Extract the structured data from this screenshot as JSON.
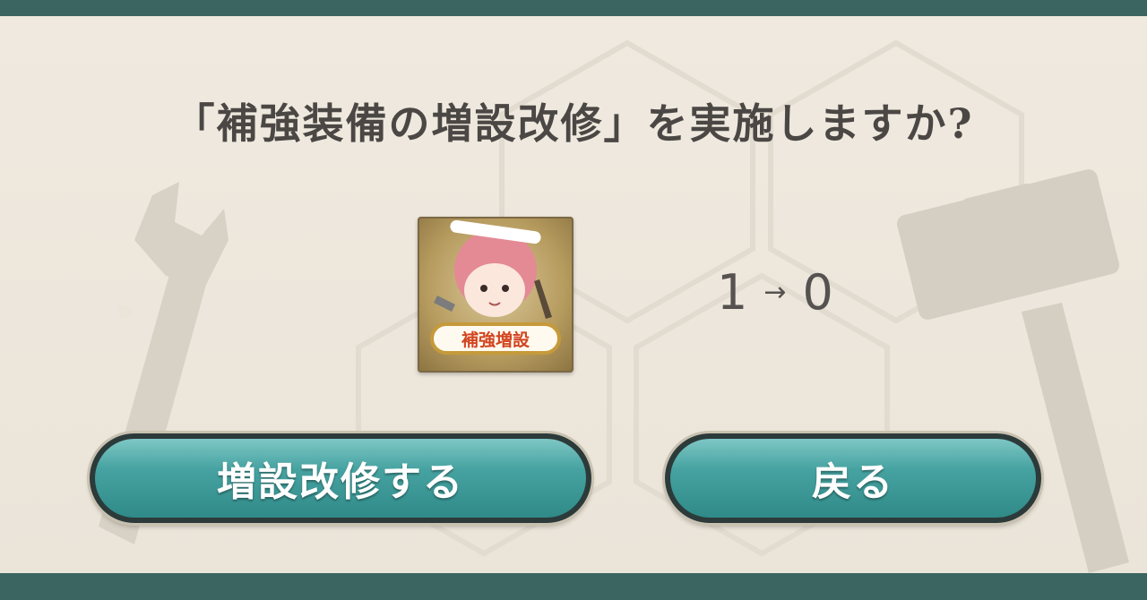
{
  "dialog": {
    "title": "「補強装備の増設改修」を実施しますか?",
    "item": {
      "icon": "reinforcement-expansion-icon",
      "badge_label": "補強増設"
    },
    "change": {
      "from": "1",
      "arrow": "→",
      "to": "0"
    },
    "buttons": {
      "confirm_label": "増設改修する",
      "back_label": "戻る"
    }
  },
  "colors": {
    "frame": "#3b6561",
    "button": "#47a3a1",
    "button_border": "#2c3a3a",
    "background": "#ece6dc",
    "title_text": "#4a4744",
    "badge_text": "#d2441f"
  }
}
